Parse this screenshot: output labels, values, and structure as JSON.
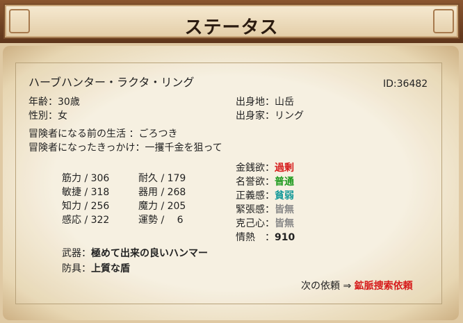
{
  "title": "ステータス",
  "character": {
    "name": "ハーブハンター・ラクタ・リング",
    "id": "ID:36482"
  },
  "profile": {
    "age": "年齢：30歳",
    "gender": "性別：女",
    "birthplace": "出身地：山岳",
    "family": "出身家：リング",
    "past_life": "冒険者になる前の生活 ：ごろつき",
    "motive": "冒険者になったきっかけ：一攫千金を狙って"
  },
  "stats": [
    {
      "label": "筋力 / 306"
    },
    {
      "label": "耐久 / 179"
    },
    {
      "label": "敏捷 / 318"
    },
    {
      "label": "器用 / 268"
    },
    {
      "label": "知力 / 256"
    },
    {
      "label": "魔力 / 205"
    },
    {
      "label": "感応 / 322"
    },
    {
      "label": "運勢 /　 6"
    }
  ],
  "traits": [
    {
      "label": "金銭欲：",
      "value": "過剰",
      "color": "#d61b1b"
    },
    {
      "label": "名誉欲：",
      "value": "普通",
      "color": "#1e9a1e"
    },
    {
      "label": "正義感：",
      "value": "貧弱",
      "color": "#169a9a"
    },
    {
      "label": "緊張感：",
      "value": "皆無",
      "color": "#888888"
    },
    {
      "label": "克己心：",
      "value": "皆無",
      "color": "#888888"
    },
    {
      "label": "情熱　：",
      "value": "910",
      "color": "#222222"
    }
  ],
  "equipment": {
    "weapon_label": "武器：",
    "weapon": "極めて出来の良いハンマー",
    "armor_label": "防具：",
    "armor": "上質な盾"
  },
  "next_request": {
    "label": "次の依頼 ⇒",
    "value": "鉱脈捜索依頼"
  }
}
